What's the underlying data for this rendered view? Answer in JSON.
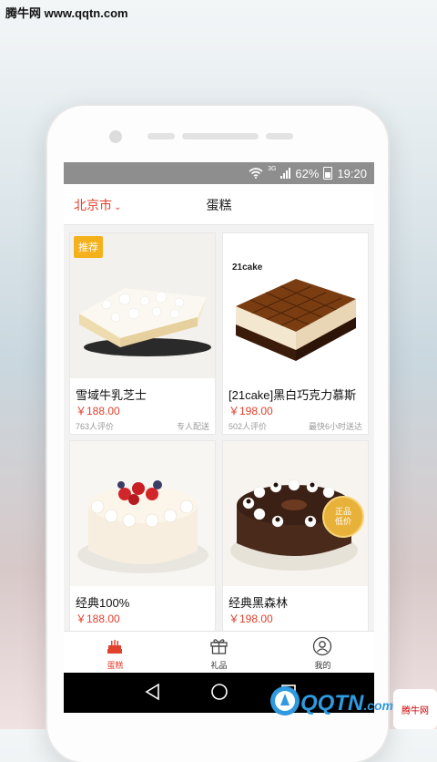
{
  "watermark": {
    "site": "腾牛网 www.qqtn.com",
    "logo_text": "QQTN",
    "logo_suffix": ".com",
    "corner_logo": "腾牛网"
  },
  "statusbar": {
    "network": "3G",
    "battery": "62%",
    "time": "19:20"
  },
  "header": {
    "city": "北京市",
    "title": "蛋糕"
  },
  "products": [
    {
      "name": "雪域牛乳芝士",
      "price": "￥188.00",
      "reviews": "763人评价",
      "delivery": "专人配送",
      "tag": "推荐"
    },
    {
      "name": "[21cake]黑白巧克力慕斯",
      "price": "￥198.00",
      "reviews": "502人评价",
      "delivery": "最快6小时送达",
      "brand_logo": "21cake"
    },
    {
      "name": "经典100%",
      "price": "￥188.00",
      "reviews": "",
      "delivery": ""
    },
    {
      "name": "经典黑森林",
      "price": "￥198.00",
      "reviews": "",
      "delivery": "",
      "seal_line1": "正品",
      "seal_line2": "低价"
    }
  ],
  "tabs": [
    {
      "label": "蛋糕",
      "icon": "cake-icon",
      "active": true
    },
    {
      "label": "礼品",
      "icon": "gift-icon",
      "active": false
    },
    {
      "label": "我的",
      "icon": "user-icon",
      "active": false
    }
  ],
  "colors": {
    "accent": "#e0412d",
    "tag": "#f5b11c",
    "statusbar": "#8e8e8e"
  }
}
